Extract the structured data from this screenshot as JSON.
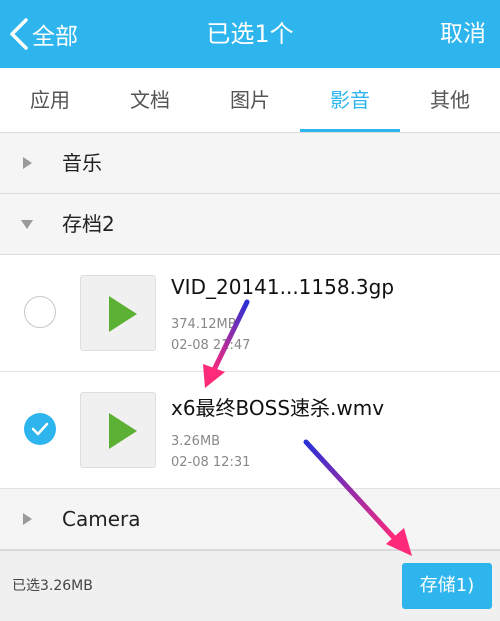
{
  "header": {
    "back_label": "全部",
    "title": "已选1个",
    "cancel_label": "取消"
  },
  "tabs": [
    {
      "label": "应用",
      "active": false
    },
    {
      "label": "文档",
      "active": false
    },
    {
      "label": "图片",
      "active": false
    },
    {
      "label": "影音",
      "active": true
    },
    {
      "label": "其他",
      "active": false
    }
  ],
  "groups": {
    "music": {
      "label": "音乐",
      "expanded": false
    },
    "archive": {
      "label": "存档2",
      "expanded": true
    },
    "camera": {
      "label": "Camera",
      "expanded": false
    }
  },
  "files": [
    {
      "name": "VID_20141...1158.3gp",
      "size": "374.12MB",
      "date": "02-08 21:47",
      "checked": false,
      "icon": "play-icon"
    },
    {
      "name": "x6最终BOSS速杀.wmv",
      "size": "3.26MB",
      "date": "02-08 12:31",
      "checked": true,
      "icon": "play-icon"
    }
  ],
  "footer": {
    "selected_size": "已选3.26MB",
    "store_label": "存储1)"
  },
  "colors": {
    "accent": "#2fb5ee",
    "play_green": "#5cb135",
    "annotation_arrow": [
      "#2b2fd6",
      "#ff2a7a"
    ]
  }
}
